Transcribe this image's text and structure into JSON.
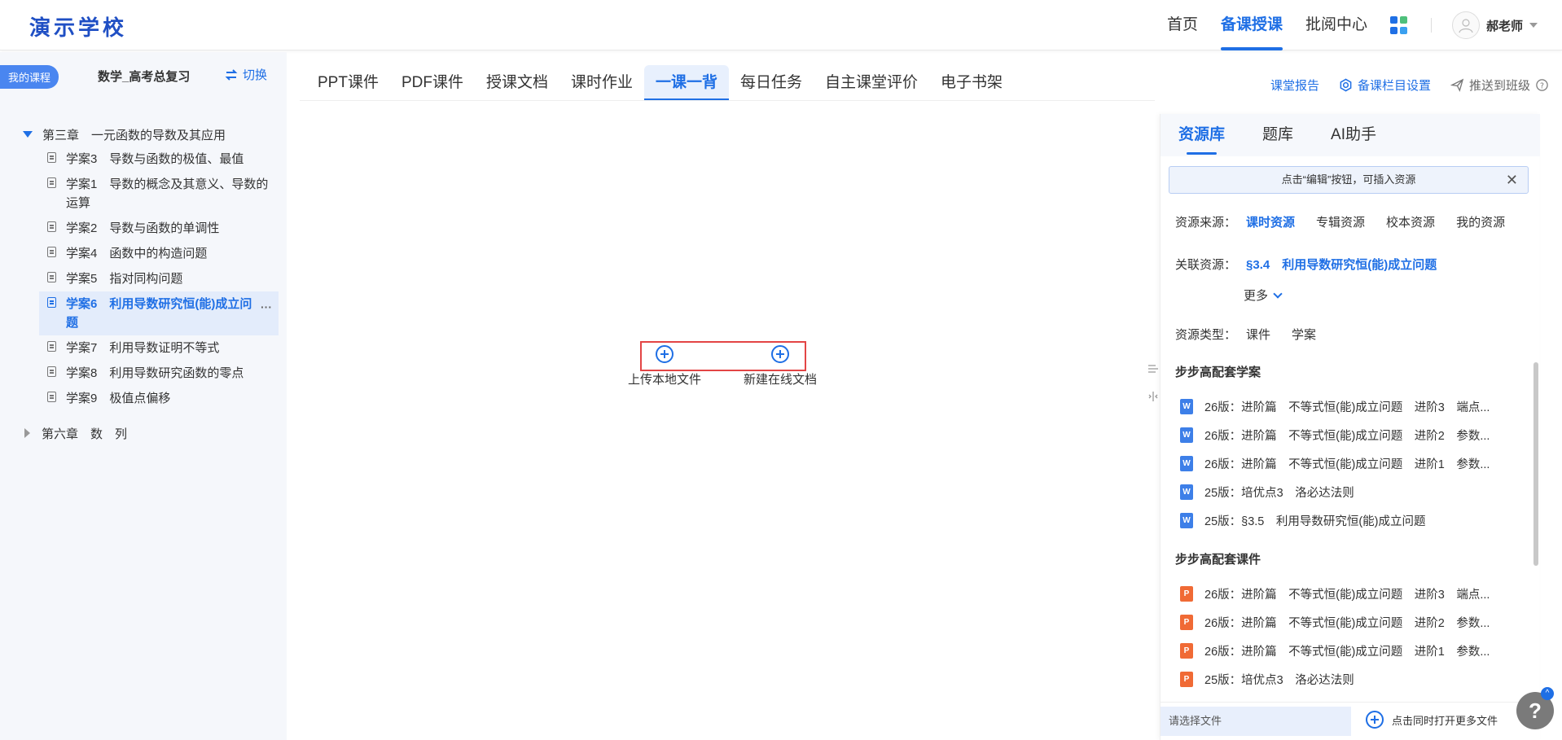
{
  "header": {
    "logo": "演示学校",
    "nav": [
      "首页",
      "备课授课",
      "批阅中心"
    ],
    "active_nav": "备课授课",
    "user_name": "郝老师",
    "app_colors": [
      "#1f6fe5",
      "#4ec07b",
      "#1f6fe5",
      "#3aa0f0"
    ]
  },
  "sidebar": {
    "my_course": "我的课程",
    "course_title": "数学_高考总复习",
    "switch_label": "切换",
    "chapter1": "第三章　一元函数的导数及其应用",
    "lessons": [
      {
        "num": "学案3",
        "title": "导数与函数的极值、最值"
      },
      {
        "num": "学案1",
        "title": "导数的概念及其意义、导数的运算"
      },
      {
        "num": "学案2",
        "title": "导数与函数的单调性"
      },
      {
        "num": "学案4",
        "title": "函数中的构造问题"
      },
      {
        "num": "学案5",
        "title": "指对同构问题"
      },
      {
        "num": "学案6",
        "title": "利用导数研究恒(能)成立问题"
      },
      {
        "num": "学案7",
        "title": "利用导数证明不等式"
      },
      {
        "num": "学案8",
        "title": "利用导数研究函数的零点"
      },
      {
        "num": "学案9",
        "title": "极值点偏移"
      }
    ],
    "chapter2": "第六章　数　列"
  },
  "tabs": [
    "PPT课件",
    "PDF课件",
    "授课文档",
    "课时作业",
    "一课一背",
    "每日任务",
    "自主课堂评价",
    "电子书架"
  ],
  "active_tab": "一课一背",
  "actions": {
    "report": "课堂报告",
    "settings": "备课栏目设置",
    "push": "推送到班级"
  },
  "center": {
    "upload_local": "上传本地文件",
    "new_doc": "新建在线文档"
  },
  "panel": {
    "tabs": [
      "资源库",
      "题库",
      "AI助手"
    ],
    "notice": "点击“编辑”按钮，可插入资源",
    "source_label": "资源来源：",
    "sources": [
      "课时资源",
      "专辑资源",
      "校本资源",
      "我的资源"
    ],
    "assoc_label": "关联资源：",
    "assoc_value": "§3.4　利用导数研究恒(能)成立问题",
    "more": "更多",
    "type_label": "资源类型：",
    "types": [
      "课件",
      "学案"
    ],
    "section1": "步步高配套学案",
    "section1_items": [
      "26版：进阶篇　不等式恒(能)成立问题　进阶3　端点...",
      "26版：进阶篇　不等式恒(能)成立问题　进阶2　参数...",
      "26版：进阶篇　不等式恒(能)成立问题　进阶1　参数...",
      "25版：培优点3　洛必达法则",
      "25版：§3.5　利用导数研究恒(能)成立问题"
    ],
    "section2": "步步高配套课件",
    "section2_items": [
      "26版：进阶篇　不等式恒(能)成立问题　进阶3　端点...",
      "26版：进阶篇　不等式恒(能)成立问题　进阶2　参数...",
      "26版：进阶篇　不等式恒(能)成立问题　进阶1　参数...",
      "25版：培优点3　洛必达法则"
    ],
    "file_select": "请选择文件",
    "open_more": "点击同时打开更多文件"
  },
  "help": "?"
}
